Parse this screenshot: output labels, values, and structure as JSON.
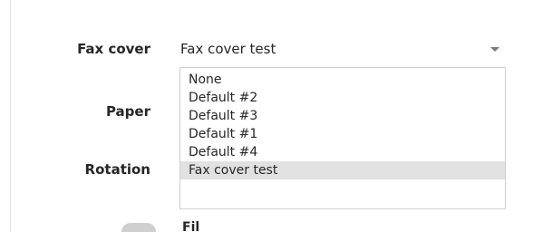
{
  "form": {
    "fax_cover_label": "Fax cover",
    "paper_label": "Paper",
    "rotation_label": "Rotation",
    "fax_cover_value": "Fax cover test",
    "partial_label": "Fil"
  },
  "dropdown": {
    "options": [
      {
        "label": "None"
      },
      {
        "label": "Default #2"
      },
      {
        "label": "Default #3"
      },
      {
        "label": "Default #1"
      },
      {
        "label": "Default #4"
      },
      {
        "label": "Fax cover test"
      }
    ],
    "selected_index": 5
  },
  "icons": {
    "dropdown_chevron": "chevron-down-icon"
  },
  "colors": {
    "selected_option_bg": "#e1e1e1",
    "dropdown_border": "#cfcfcf",
    "text": "#262626"
  }
}
